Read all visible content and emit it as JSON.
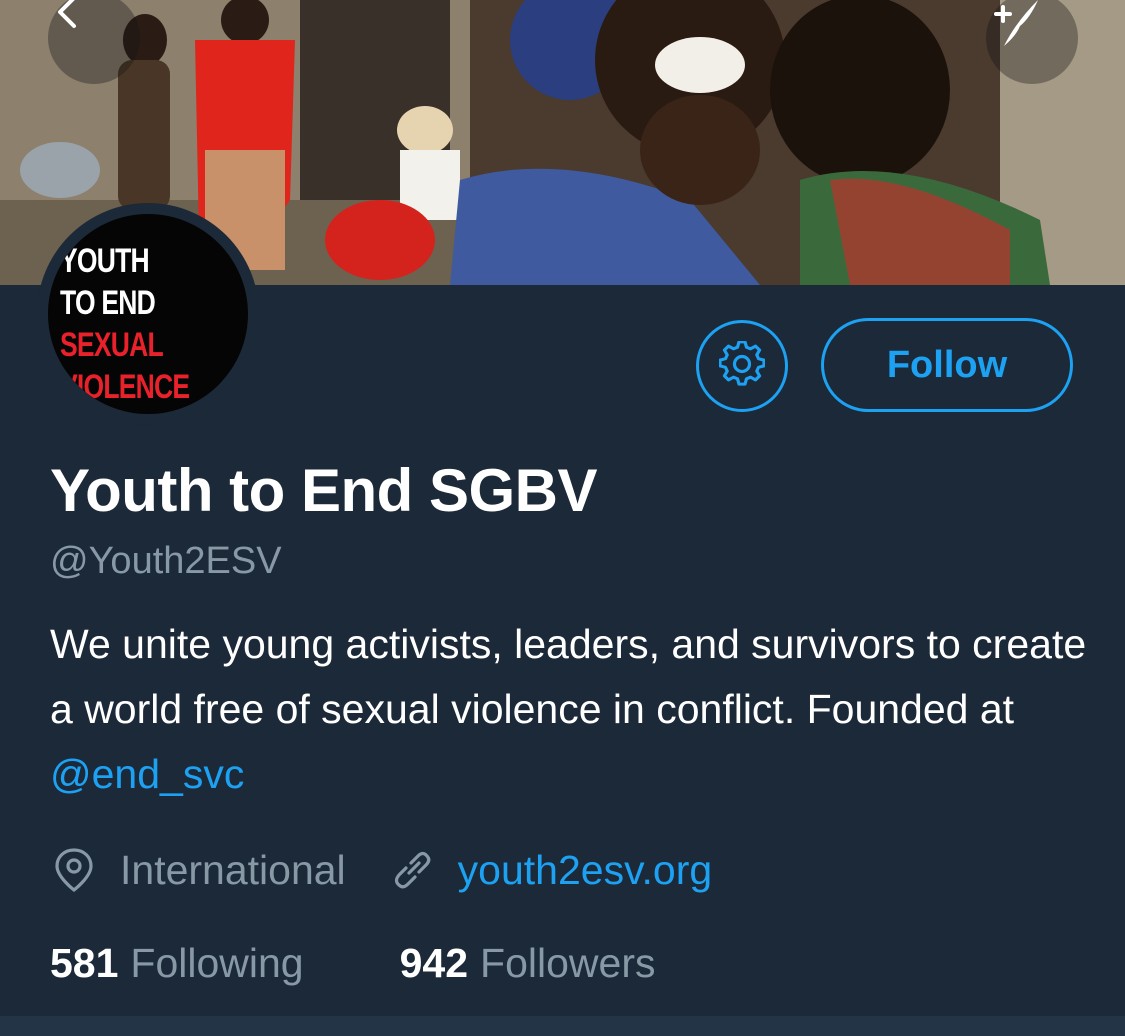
{
  "banner": {
    "description_icon_back": "chevron-left-icon",
    "compose_icon": "feather-plus-icon"
  },
  "avatar": {
    "line1": "YOUTH",
    "line2": "TO END",
    "line3": "SEXUAL",
    "line4": "VIOLENCE"
  },
  "profile": {
    "name": "Youth to End SGBV",
    "handle": "@Youth2ESV",
    "bio_text": "We unite young activists, leaders, and survivors to create a world free of sexual violence in conflict. Founded at ",
    "bio_mention": "@end_svc",
    "location": "International",
    "website": "youth2esv.org"
  },
  "actions": {
    "follow_label": "Follow",
    "settings_icon": "gear-icon"
  },
  "stats": {
    "following_count": "581",
    "following_label": "Following",
    "followers_count": "942",
    "followers_label": "Followers"
  },
  "colors": {
    "background": "#1c2938",
    "accent": "#1da1f2",
    "muted": "#8899a6",
    "logo_red": "#e8212b"
  }
}
